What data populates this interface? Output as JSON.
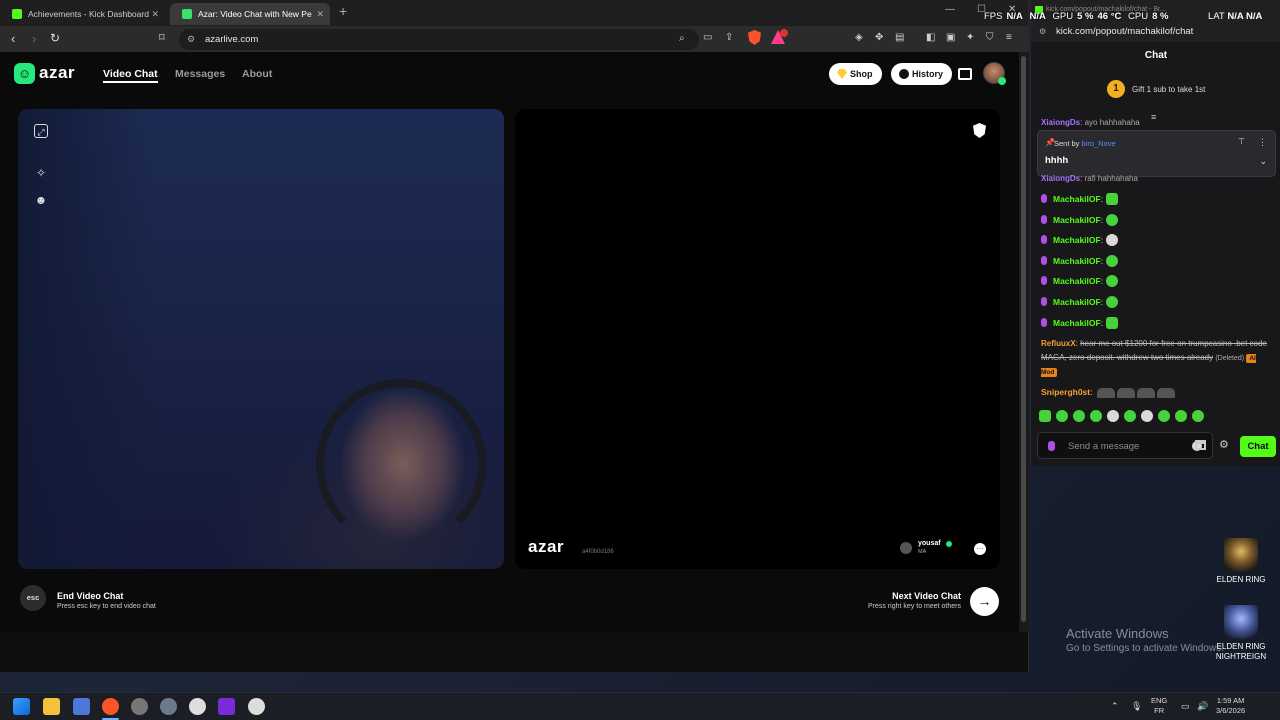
{
  "browser": {
    "tabs": [
      {
        "label": "Achievements - Kick Dashboard"
      },
      {
        "label": "Azar: Video Chat with New Pe"
      }
    ],
    "url": "azarlive.com"
  },
  "azar": {
    "logo": "azar",
    "nav": {
      "video_chat": "Video Chat",
      "messages": "Messages",
      "about": "About"
    },
    "shop": "Shop",
    "history": "History",
    "peer": {
      "watermark": "azar",
      "id": "a4f0b0d186",
      "username": "yousaf",
      "country": "MA"
    },
    "end": {
      "key": "esc",
      "title": "End Video Chat",
      "subtitle": "Press esc key to end video chat"
    },
    "next": {
      "title": "Next Video Chat",
      "subtitle": "Press right key to meet others",
      "arrow": "→"
    }
  },
  "chat": {
    "window_title": "kick.com/popout/machakilof/chat - Br...",
    "url": "kick.com/popout/machakilof/chat",
    "header": "Chat",
    "gift": {
      "count": "1",
      "text": "Gift 1 sub to take 1st"
    },
    "pinned": {
      "sent_by_label": "Sent by",
      "sent_by_user": "biro_Nove",
      "text": "hhhh"
    },
    "clipped_messages": [
      {
        "user": "XiaiongDs",
        "text": "ayo hahhahaha"
      },
      {
        "user": "XiaiongDs",
        "text": "rafi hahhahaha"
      }
    ],
    "messages": [
      {
        "user": "MachakilOF",
        "sep": ":"
      },
      {
        "user": "MachakilOF",
        "sep": ":"
      },
      {
        "user": "MachakilOF",
        "sep": ":"
      },
      {
        "user": "MachakilOF",
        "sep": ":"
      },
      {
        "user": "MachakilOF",
        "sep": ":"
      },
      {
        "user": "MachakilOF",
        "sep": ":"
      },
      {
        "user": "MachakilOF",
        "sep": ":"
      }
    ],
    "reflux": {
      "user": "RefluuxX",
      "text": "hear me out $1200 for free on trumpcasino .bet code MAGA, zero deposit. withdrew two times already",
      "deleted": "(Deleted)",
      "badge": "AI Mod"
    },
    "sniper": {
      "user": "Snipergh0st",
      "sep": ":"
    },
    "input_placeholder": "Send a message",
    "send_label": "Chat"
  },
  "overlay": {
    "fps_label": "FPS",
    "fps": "N/A",
    "gpu_label": "GPU",
    "gpu_usage": "5 %",
    "gpu_temp": "46 °C",
    "cpu_label": "CPU",
    "cpu": "8 %",
    "lat_label": "LAT",
    "lat": "N/A",
    "extra": "N/A"
  },
  "desktop": {
    "icons": [
      {
        "label": "ELDEN RING"
      },
      {
        "label": "ELDEN RING NIGHTREIGN"
      }
    ],
    "activate_title": "Activate Windows",
    "activate_sub": "Go to Settings to activate Windows."
  },
  "taskbar": {
    "lang_1": "ENG",
    "lang_2": "FR",
    "time": "1:59 AM",
    "date": "3/6/2026"
  }
}
